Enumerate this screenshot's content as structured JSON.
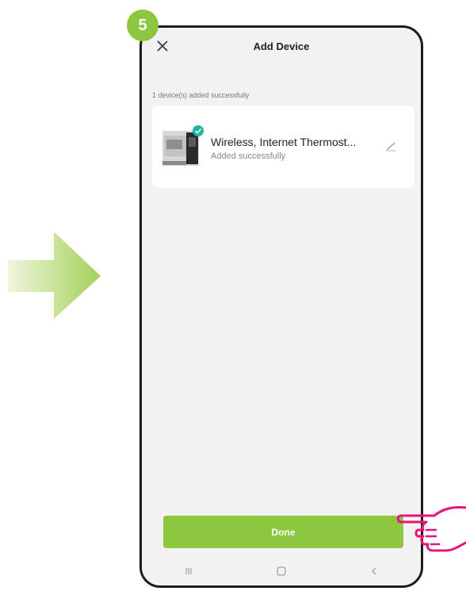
{
  "step": {
    "number": "5"
  },
  "header": {
    "title": "Add Device"
  },
  "summary": {
    "added_count_text": "1 device(s) added successfully"
  },
  "device": {
    "name": "Wireless, Internet Thermost...",
    "status": "Added successfully"
  },
  "actions": {
    "done_label": "Done"
  },
  "nav": {
    "icons": [
      "recent-apps-icon",
      "home-icon",
      "back-icon"
    ]
  },
  "colors": {
    "accent": "#8dc63f",
    "phone_bg": "#f2f2f2",
    "card_bg": "#ffffff",
    "hand": "#e5147a",
    "check": "#1fb5a0"
  }
}
